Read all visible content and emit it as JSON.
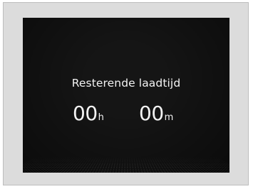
{
  "display": {
    "title": "Resterende laadtijd",
    "hours_value": "00",
    "hours_unit": "h",
    "minutes_value": "00",
    "minutes_unit": "m"
  },
  "colors": {
    "screen_background": "#151515",
    "text": "#f2f2f2",
    "frame": "#dcdcdc"
  }
}
